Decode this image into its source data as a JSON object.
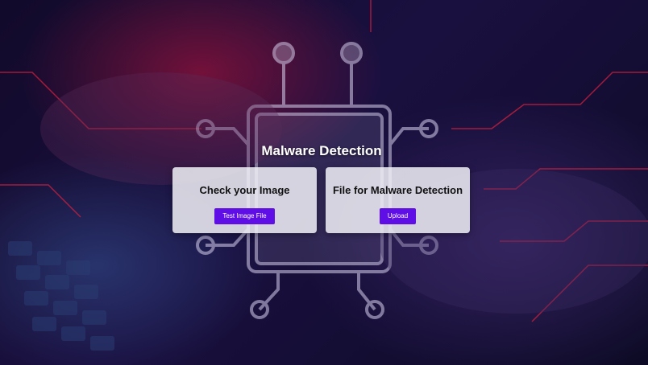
{
  "page": {
    "title": "Malware Detection"
  },
  "cards": [
    {
      "heading": "Check your Image",
      "button_label": "Test Image File"
    },
    {
      "heading": "File for Malware Detection",
      "button_label": "Upload"
    }
  ],
  "colors": {
    "accent": "#5f0fe6",
    "card_background": "#f0f0f6",
    "background": "#1a1040",
    "circuit_red": "#d0203f"
  }
}
